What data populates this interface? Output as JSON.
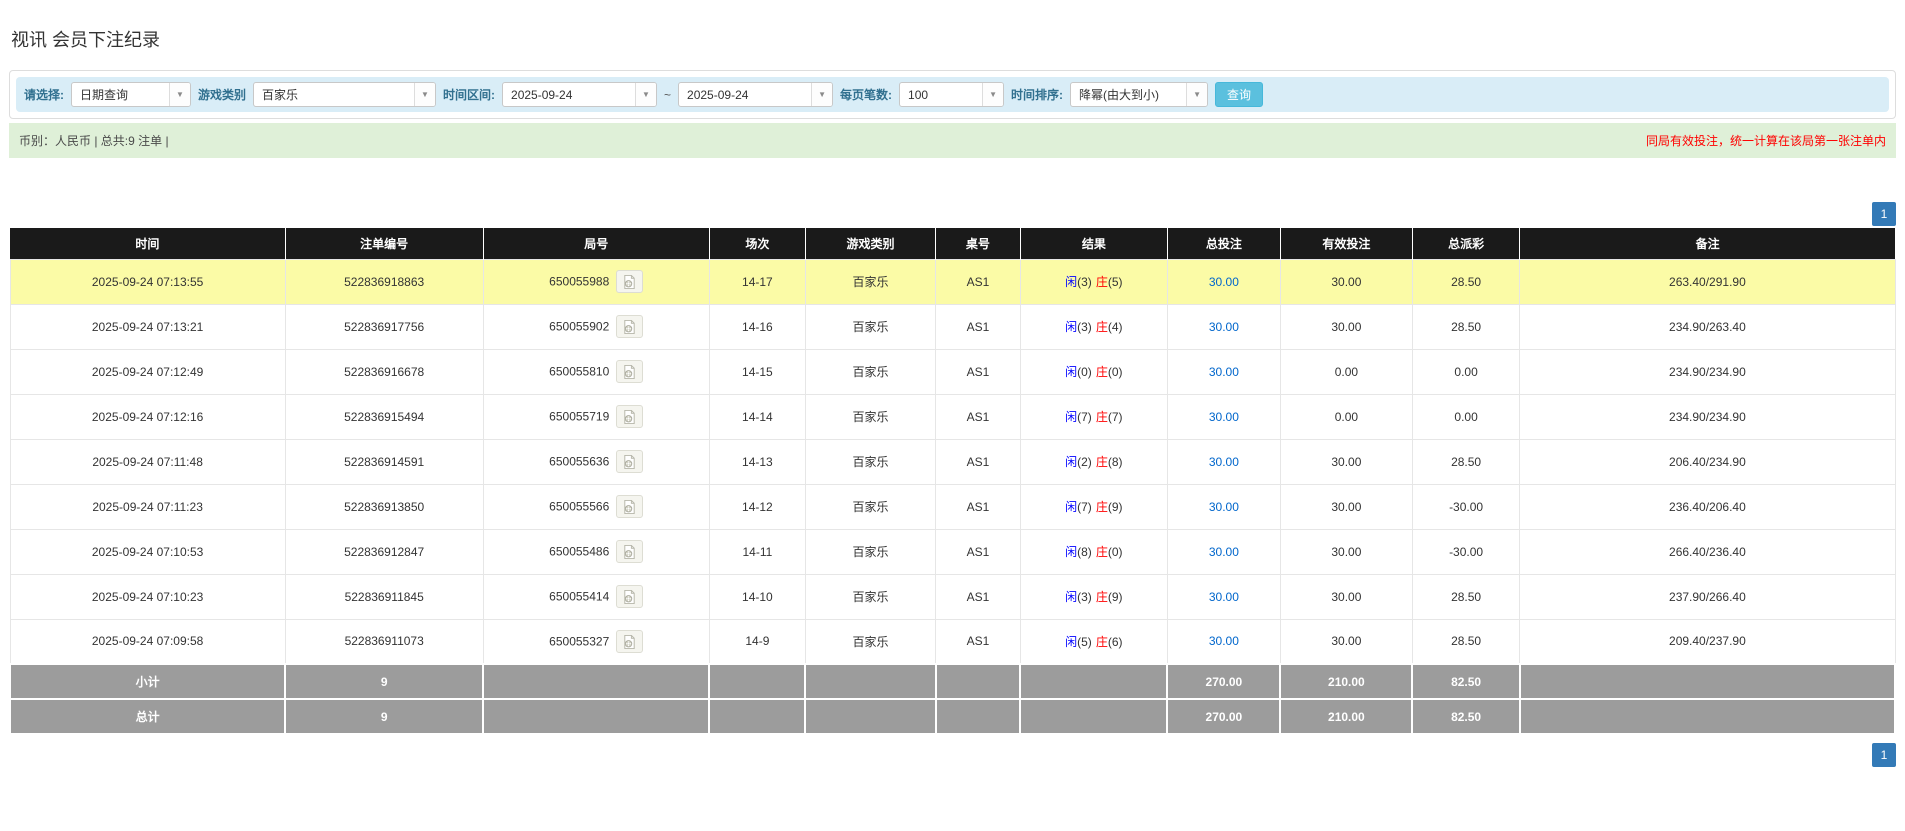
{
  "page_title": "视讯 会员下注纪录",
  "filter_bar": {
    "select_label": "请选择:",
    "select_value": "日期查询",
    "game_type_label": "游戏类别",
    "game_type_value": "百家乐",
    "time_range_label": "时间区间:",
    "date_from": "2025-09-24",
    "range_separator": "~",
    "date_to": "2025-09-24",
    "page_size_label": "每页笔数:",
    "page_size_value": "100",
    "time_sort_label": "时间排序:",
    "time_sort_value": "降幂(由大到小)",
    "search_button_label": "查询",
    "accent_color": "#5bc0de"
  },
  "summary_bar": {
    "left_text": "币别：人民币 | 总共:9 注单 |",
    "right_notice": "同局有效投注，统一计算在该局第一张注单内",
    "notice_color": "#ff0000",
    "background": "#dff0d8"
  },
  "pagination": {
    "current_page": "1",
    "active_color": "#337ab7"
  },
  "table": {
    "headers": [
      "时间",
      "注单编号",
      "局号",
      "场次",
      "游戏类别",
      "桌号",
      "结果",
      "总投注",
      "有效投注",
      "总派彩",
      "备注"
    ],
    "result_labels": {
      "player": "闲",
      "banker": "庄"
    },
    "result_colors": {
      "player": "#0000ff",
      "banker": "#ff0000"
    },
    "round_icon": "video-record-icon",
    "rows": [
      {
        "time": "2025-09-24 07:13:55",
        "bet_id": "522836918863",
        "round_id": "650055988",
        "session": "14-17",
        "game": "百家乐",
        "table_no": "AS1",
        "player_score": "(3)",
        "banker_score": "(5)",
        "total_bet": "30.00",
        "valid_bet": "30.00",
        "payout": "28.50",
        "remark": "263.40/291.90",
        "highlight": true
      },
      {
        "time": "2025-09-24 07:13:21",
        "bet_id": "522836917756",
        "round_id": "650055902",
        "session": "14-16",
        "game": "百家乐",
        "table_no": "AS1",
        "player_score": "(3)",
        "banker_score": "(4)",
        "total_bet": "30.00",
        "valid_bet": "30.00",
        "payout": "28.50",
        "remark": "234.90/263.40",
        "highlight": false
      },
      {
        "time": "2025-09-24 07:12:49",
        "bet_id": "522836916678",
        "round_id": "650055810",
        "session": "14-15",
        "game": "百家乐",
        "table_no": "AS1",
        "player_score": "(0)",
        "banker_score": "(0)",
        "total_bet": "30.00",
        "valid_bet": "0.00",
        "payout": "0.00",
        "remark": "234.90/234.90",
        "highlight": false
      },
      {
        "time": "2025-09-24 07:12:16",
        "bet_id": "522836915494",
        "round_id": "650055719",
        "session": "14-14",
        "game": "百家乐",
        "table_no": "AS1",
        "player_score": "(7)",
        "banker_score": "(7)",
        "total_bet": "30.00",
        "valid_bet": "0.00",
        "payout": "0.00",
        "remark": "234.90/234.90",
        "highlight": false
      },
      {
        "time": "2025-09-24 07:11:48",
        "bet_id": "522836914591",
        "round_id": "650055636",
        "session": "14-13",
        "game": "百家乐",
        "table_no": "AS1",
        "player_score": "(2)",
        "banker_score": "(8)",
        "total_bet": "30.00",
        "valid_bet": "30.00",
        "payout": "28.50",
        "remark": "206.40/234.90",
        "highlight": false
      },
      {
        "time": "2025-09-24 07:11:23",
        "bet_id": "522836913850",
        "round_id": "650055566",
        "session": "14-12",
        "game": "百家乐",
        "table_no": "AS1",
        "player_score": "(7)",
        "banker_score": "(9)",
        "total_bet": "30.00",
        "valid_bet": "30.00",
        "payout": "-30.00",
        "remark": "236.40/206.40",
        "highlight": false
      },
      {
        "time": "2025-09-24 07:10:53",
        "bet_id": "522836912847",
        "round_id": "650055486",
        "session": "14-11",
        "game": "百家乐",
        "table_no": "AS1",
        "player_score": "(8)",
        "banker_score": "(0)",
        "total_bet": "30.00",
        "valid_bet": "30.00",
        "payout": "-30.00",
        "remark": "266.40/236.40",
        "highlight": false
      },
      {
        "time": "2025-09-24 07:10:23",
        "bet_id": "522836911845",
        "round_id": "650055414",
        "session": "14-10",
        "game": "百家乐",
        "table_no": "AS1",
        "player_score": "(3)",
        "banker_score": "(9)",
        "total_bet": "30.00",
        "valid_bet": "30.00",
        "payout": "28.50",
        "remark": "237.90/266.40",
        "highlight": false
      },
      {
        "time": "2025-09-24 07:09:58",
        "bet_id": "522836911073",
        "round_id": "650055327",
        "session": "14-9",
        "game": "百家乐",
        "table_no": "AS1",
        "player_score": "(5)",
        "banker_score": "(6)",
        "total_bet": "30.00",
        "valid_bet": "30.00",
        "payout": "28.50",
        "remark": "209.40/237.90",
        "highlight": false
      }
    ],
    "footer": [
      {
        "label": "小计",
        "count": "9",
        "total_bet": "270.00",
        "valid_bet": "210.00",
        "payout": "82.50"
      },
      {
        "label": "总计",
        "count": "9",
        "total_bet": "270.00",
        "valid_bet": "210.00",
        "payout": "82.50"
      }
    ]
  }
}
